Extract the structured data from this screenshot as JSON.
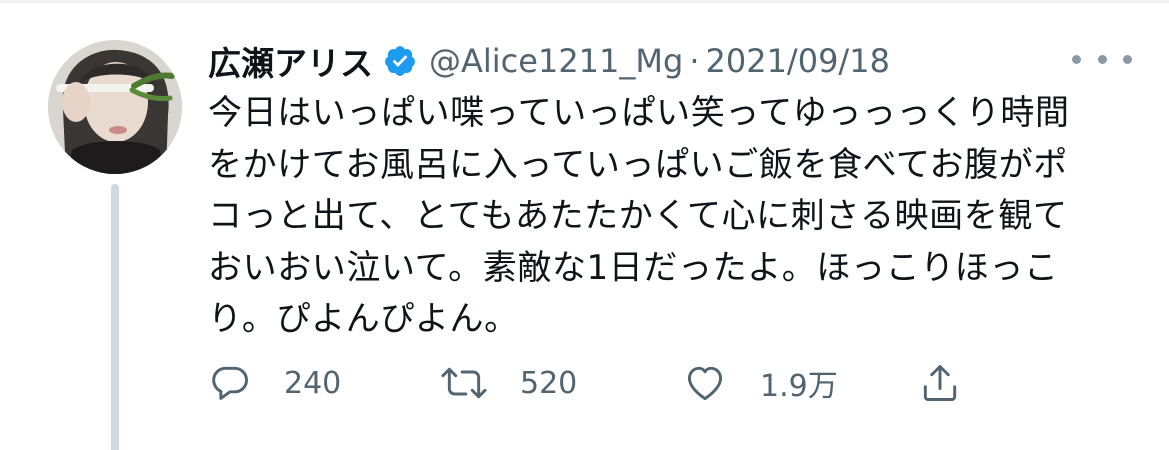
{
  "user": {
    "display_name": "広瀬アリス",
    "verified": true,
    "handle": "@Alice1211_Mg",
    "separator": "·",
    "date": "2021/09/18"
  },
  "tweet": {
    "lines": [
      "今日はいっぱい喋っていっぱい笑ってゆっっっくり時間",
      "をかけてお風呂に入っていっぱいご飯を食べてお腹がポ",
      "コっと出て、とてもあたたかくて心に刺さる映画を観て",
      "おいおい泣いて。素敵な1日だったよ。ほっこりほっこ",
      "り。ぴよんぴよん。"
    ]
  },
  "actions": {
    "reply_count": "240",
    "retweet_count": "520",
    "like_count": "1.9万"
  },
  "icons": {
    "verified": "verified-badge-icon",
    "more": "more-dots-icon",
    "reply": "reply-icon",
    "retweet": "retweet-icon",
    "like": "heart-icon",
    "share": "share-icon"
  },
  "colors": {
    "primary_text": "#0f1419",
    "secondary_text": "#536471",
    "verified_blue": "#1d9bf0",
    "thread_line": "#cfd9de"
  }
}
